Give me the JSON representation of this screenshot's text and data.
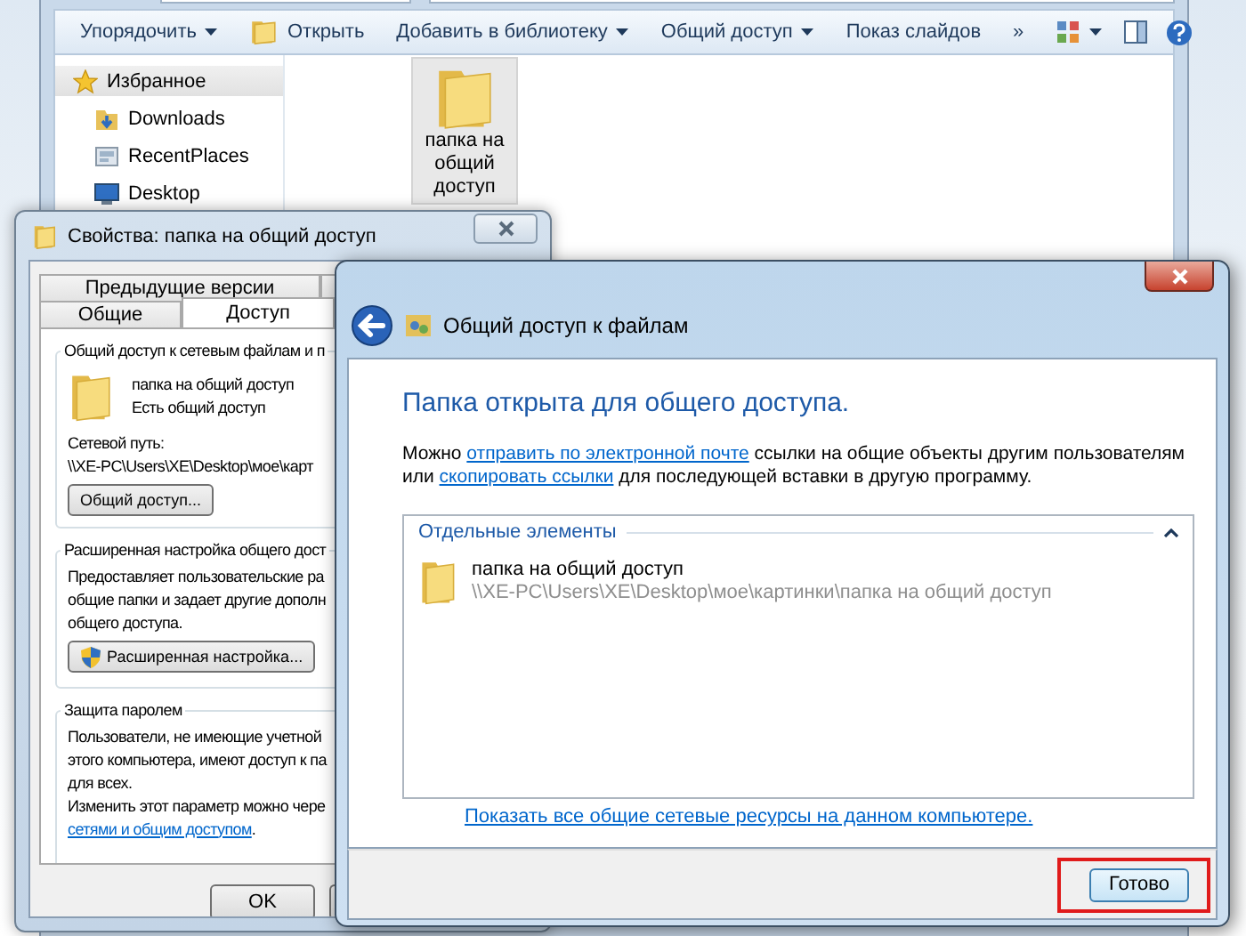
{
  "explorer": {
    "toolbar": [
      {
        "label": "Упорядочить",
        "kind": "menu",
        "dropdown": true
      },
      {
        "label": "Открыть",
        "kind": "open",
        "dropdown": false
      },
      {
        "label": "Добавить в библиотеку",
        "kind": "menu",
        "dropdown": true
      },
      {
        "label": "Общий доступ",
        "kind": "menu",
        "dropdown": true
      },
      {
        "label": "Показ слайдов",
        "kind": "menu",
        "dropdown": false
      },
      {
        "label": "»",
        "kind": "more",
        "dropdown": false
      }
    ],
    "sidebar": {
      "items": [
        {
          "label": "Избранное",
          "kind": "favorites",
          "selected": true
        },
        {
          "label": "Downloads",
          "kind": "downloads",
          "selected": false
        },
        {
          "label": "RecentPlaces",
          "kind": "recent",
          "selected": false
        },
        {
          "label": "Desktop",
          "kind": "desktop",
          "selected": false
        }
      ]
    },
    "files": [
      {
        "name": "папка на общий доступ",
        "selected": true
      }
    ]
  },
  "properties_dialog": {
    "title": "Свойства: папка на общий доступ",
    "tab_rows": [
      [
        {
          "label": "Предыдущие версии",
          "selected": false
        }
      ],
      [
        {
          "label": "Общие",
          "selected": false
        },
        {
          "label": "Доступ",
          "selected": true
        }
      ]
    ],
    "sharing_group": {
      "title": "Общий доступ к сетевым файлам и п",
      "folder_name": "папка на общий доступ",
      "status": "Есть общий доступ",
      "path_label": "Сетевой путь:",
      "path": "\\\\XE-PC\\Users\\XE\\Desktop\\мое\\карт",
      "button": "Общий доступ..."
    },
    "advanced_group": {
      "title": "Расширенная настройка общего дост",
      "lines": [
        "Предоставляет пользовательские ра",
        "общие папки и задает другие дополн",
        "общего доступа."
      ],
      "button": "Расширенная настройка..."
    },
    "password_group": {
      "title": "Защита паролем",
      "lines": [
        "Пользователи, не имеющие учетной",
        "этого компьютера, имеют доступ к па",
        "для всех.",
        "Изменить этот параметр можно чере"
      ],
      "link": "сетями и общим доступом",
      "link_tail": "."
    },
    "buttons": [
      "OK"
    ]
  },
  "sharing_dialog": {
    "title": "Общий доступ к файлам",
    "heading": "Папка открыта для общего доступа.",
    "message": [
      {
        "text": "Можно ",
        "link": false
      },
      {
        "text": "отправить по электронной почте",
        "link": true
      },
      {
        "text": " ссылки на общие объекты другим пользователям или ",
        "link": false
      },
      {
        "text": "скопировать ссылки",
        "link": true
      },
      {
        "text": " для последующей вставки в другую программу.",
        "link": false
      }
    ],
    "items_group": {
      "title": "Отдельные элементы",
      "expanded": true,
      "items": [
        {
          "name": "папка на общий доступ",
          "path": "\\\\XE-PC\\Users\\XE\\Desktop\\мое\\картинки\\папка на общий доступ"
        }
      ]
    },
    "show_all_link": "Показать все общие сетевые ресурсы на данном компьютере.",
    "done_button": {
      "label": "Готово",
      "highlighted": true
    }
  }
}
